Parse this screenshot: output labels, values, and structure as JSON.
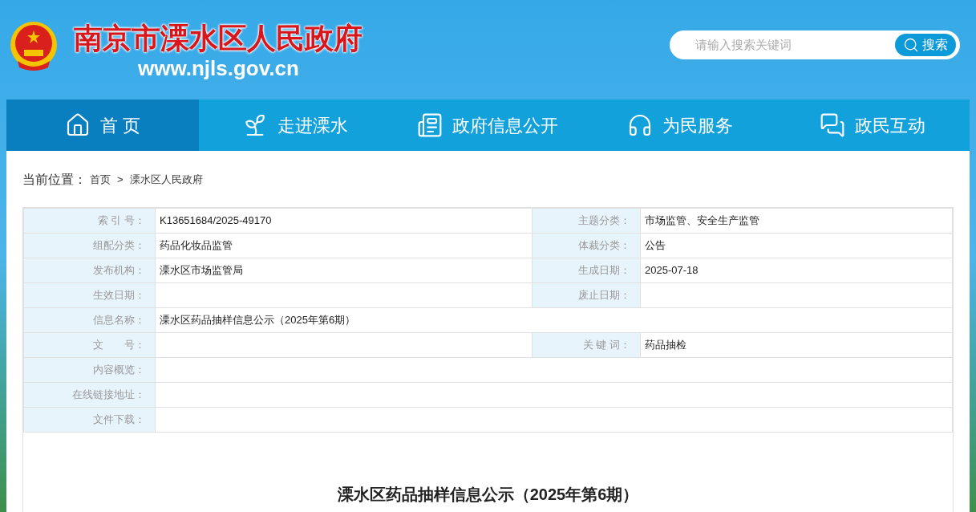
{
  "site": {
    "title": "南京市溧水区人民政府",
    "url": "www.njls.gov.cn"
  },
  "search": {
    "placeholder": "请输入搜索关键词",
    "button": "搜索"
  },
  "nav": [
    {
      "label": "首 页",
      "selected": true
    },
    {
      "label": "走进溧水",
      "selected": false
    },
    {
      "label": "政府信息公开",
      "selected": false
    },
    {
      "label": "为民服务",
      "selected": false
    },
    {
      "label": "政民互动",
      "selected": false
    }
  ],
  "breadcrumb": {
    "label": "当前位置：",
    "items": [
      "首页",
      "溧水区人民政府"
    ],
    "separator": ">"
  },
  "info_table": [
    {
      "cells": [
        {
          "label": "索 引 号：",
          "value": "K13651684/2025-49170"
        },
        {
          "label": "主题分类：",
          "value": "市场监管、安全生产监管"
        }
      ]
    },
    {
      "cells": [
        {
          "label": "组配分类：",
          "value": "药品化妆品监管"
        },
        {
          "label": "体裁分类：",
          "value": "公告"
        }
      ]
    },
    {
      "cells": [
        {
          "label": "发布机构：",
          "value": "溧水区市场监管局"
        },
        {
          "label": "生成日期：",
          "value": "2025-07-18"
        }
      ]
    },
    {
      "cells": [
        {
          "label": "生效日期："
        },
        {
          "label": "废止日期："
        }
      ]
    },
    {
      "cells": [
        {
          "label": "信息名称：",
          "value": "溧水区药品抽样信息公示（2025年第6期）"
        }
      ]
    },
    {
      "cells": [
        {
          "label": "文　　号："
        },
        {
          "label": "关 键 词：",
          "value": "药品抽检"
        }
      ]
    },
    {
      "cells": [
        {
          "label": "内容概览："
        }
      ]
    },
    {
      "cells": [
        {
          "label": "在线链接地址："
        }
      ]
    },
    {
      "cells": [
        {
          "label": "文件下载："
        }
      ]
    }
  ],
  "article": {
    "title": "溧水区药品抽样信息公示（2025年第6期）"
  }
}
